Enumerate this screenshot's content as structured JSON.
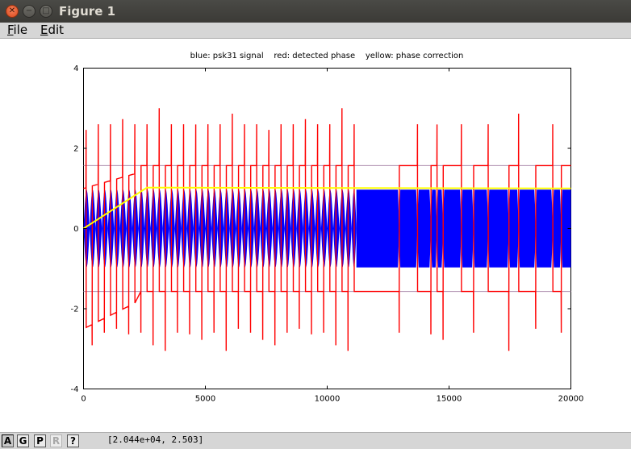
{
  "window": {
    "title": "Figure 1",
    "close_glyph": "✕",
    "minimize_glyph": "−",
    "maximize_glyph": "□"
  },
  "menu": {
    "file": {
      "mnemonic": "F",
      "rest": "ile"
    },
    "edit": {
      "mnemonic": "E",
      "rest": "dit"
    }
  },
  "chart_data": {
    "type": "line",
    "title": "blue: psk31 signal    red: detected phase    yellow: phase correction",
    "xlabel": "",
    "ylabel": "",
    "xlim": [
      0,
      20000
    ],
    "ylim": [
      -4,
      4
    ],
    "x_ticks": [
      0,
      5000,
      10000,
      15000,
      20000
    ],
    "y_ticks": [
      -4,
      -2,
      0,
      2,
      4
    ],
    "grid": false,
    "reference_lines": [
      1.57,
      -1.57
    ],
    "series": [
      {
        "name": "psk31 signal",
        "color": "#0000ff",
        "envelope": {
          "amplitude": 0.97,
          "segments": [
            {
              "x_range": [
                0,
                11200
              ],
              "symbol_period": 250,
              "phase_reversals": "every symbol"
            },
            {
              "x_range": [
                11200,
                20000
              ],
              "symbol_period": 250,
              "phase_reversals": [
                12950,
                13700,
                14250,
                14500,
                14750,
                15500,
                16000,
                16600,
                17450,
                17850,
                18550,
                19250,
                19600
              ]
            }
          ]
        }
      },
      {
        "name": "detected phase",
        "color": "#ff0000",
        "baseline_after_convergence": [
          1.57,
          -1.57
        ],
        "initial_ramp": {
          "x": [
            0,
            2300
          ],
          "high": [
            1.0,
            1.4
          ],
          "low": [
            -2.5,
            -1.8
          ]
        },
        "spike_positions": [
          100,
          350,
          600,
          850,
          1100,
          1350,
          1600,
          1850,
          2100,
          2350,
          2600,
          2850,
          3100,
          3350,
          3600,
          3850,
          4100,
          4350,
          4600,
          4850,
          5100,
          5350,
          5600,
          5850,
          6100,
          6350,
          6600,
          6850,
          7100,
          7350,
          7600,
          7850,
          8100,
          8350,
          8600,
          8850,
          9100,
          9350,
          9600,
          9850,
          10100,
          10350,
          10600,
          10850,
          11100,
          12950,
          13700,
          14250,
          14500,
          14750,
          15500,
          16000,
          16600,
          17450,
          17850,
          18550,
          19250,
          19600
        ],
        "spike_extremes": {
          "max": 3.0,
          "min": -3.05
        }
      },
      {
        "name": "phase correction",
        "color": "#ffff00",
        "points": [
          [
            0,
            0
          ],
          [
            2600,
            1.02
          ],
          [
            3500,
            1.02
          ],
          [
            20000,
            1.0
          ]
        ]
      }
    ]
  },
  "toolbar": {
    "buttons": [
      {
        "label": "A",
        "state": "active"
      },
      {
        "label": "G",
        "state": "normal"
      },
      {
        "label": "P",
        "state": "normal"
      },
      {
        "label": "R",
        "state": "disabled"
      },
      {
        "label": "?",
        "state": "normal"
      }
    ]
  },
  "status": {
    "coords": "[2.044e+04, 2.503]"
  }
}
